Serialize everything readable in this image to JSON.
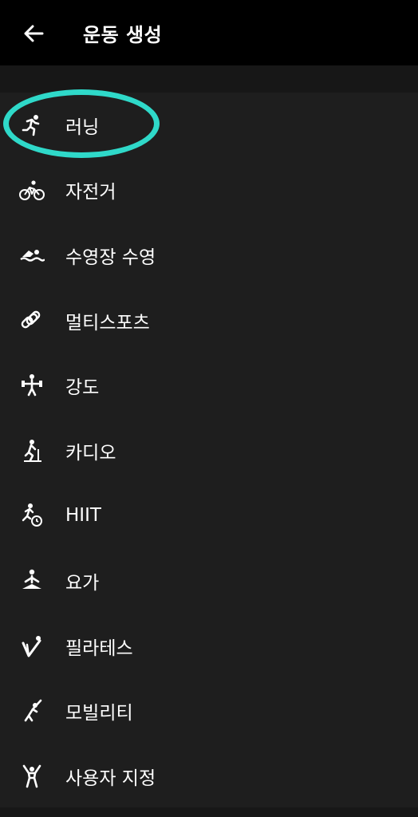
{
  "header": {
    "title": "운동 생성"
  },
  "colors": {
    "highlight": "#2fd9c9",
    "topbar": "#000000",
    "background": "#1e1e1e"
  },
  "activities": [
    {
      "label": "러닝",
      "icon": "running-icon"
    },
    {
      "label": "자전거",
      "icon": "cycling-icon"
    },
    {
      "label": "수영장 수영",
      "icon": "swimming-icon"
    },
    {
      "label": "멀티스포츠",
      "icon": "multisport-icon"
    },
    {
      "label": "강도",
      "icon": "strength-icon"
    },
    {
      "label": "카디오",
      "icon": "cardio-icon"
    },
    {
      "label": "HIIT",
      "icon": "hiit-icon"
    },
    {
      "label": "요가",
      "icon": "yoga-icon"
    },
    {
      "label": "필라테스",
      "icon": "pilates-icon"
    },
    {
      "label": "모빌리티",
      "icon": "mobility-icon"
    },
    {
      "label": "사용자 지정",
      "icon": "custom-icon"
    }
  ]
}
